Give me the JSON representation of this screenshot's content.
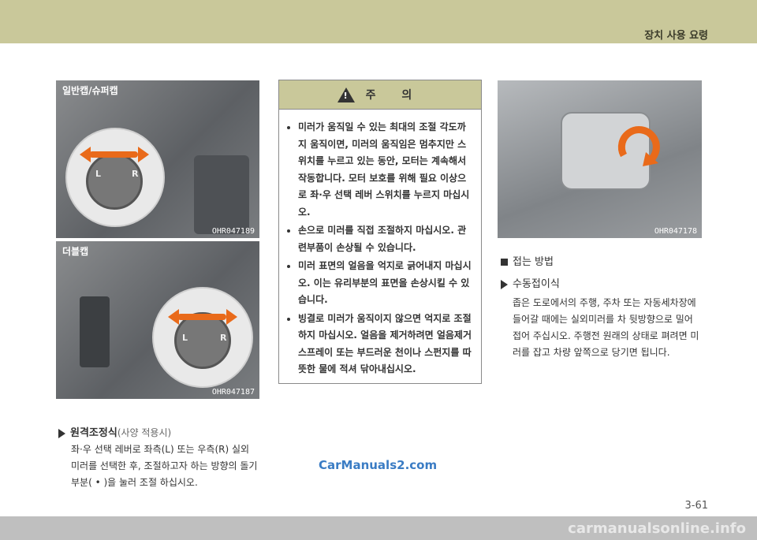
{
  "header": {
    "title": "장치 사용 요령"
  },
  "images": [
    {
      "tag": "일반캡/슈퍼캡",
      "code": "OHR047189"
    },
    {
      "tag": "더블캡",
      "code": "OHR047187"
    },
    {
      "tag": "",
      "code": "OHR047178"
    }
  ],
  "knob": {
    "left": "L",
    "right": "R"
  },
  "caution": {
    "title": "주 의",
    "icon": "!",
    "items": [
      "미러가 움직일 수 있는 최대의 조절 각도까지 움직이면, 미러의 움직임은 멈추지만 스위치를 누르고 있는 동안, 모터는 계속해서 작동합니다. 모터 보호를 위해 필요 이상으로 좌·우 선택 레버 스위치를 누르지 마십시오.",
      "손으로 미러를 직접 조절하지 마십시오. 관련부품이 손상될 수 있습니다.",
      "미러 표면의 얼음을 억지로 긁어내지 마십시오. 이는 유리부분의 표면을 손상시킬 수 있습니다.",
      "빙결로 미러가 움직이지 않으면 억지로 조절하지 마십시오. 얼음을 제거하려면 얼음제거 스프레이 또는 부드러운 천이나 스펀지를 따뜻한 물에 적셔 닦아내십시오."
    ]
  },
  "remote": {
    "heading": "원격조정식",
    "note": "(사양 적용시)",
    "body": "좌·우 선택 레버로 좌측(L) 또는 우측(R) 실외 미러를 선택한 후, 조절하고자 하는 방향의 돌기부분( • )을 눌러 조절 하십시오."
  },
  "fold": {
    "heading": "접는 방법",
    "sub": "수동접이식",
    "body": "좁은 도로에서의 주행, 주차 또는 자동세차장에 들어갈 때에는 실외미러를 차 뒷방향으로 밀어 접어 주십시오. 주행전 원래의 상태로 펴려면 미러를 잡고 차량 앞쪽으로 당기면 됩니다."
  },
  "watermark": "CarManuals2.com",
  "page_number": "3-61",
  "bottom_watermark": "carmanualsonline.info"
}
